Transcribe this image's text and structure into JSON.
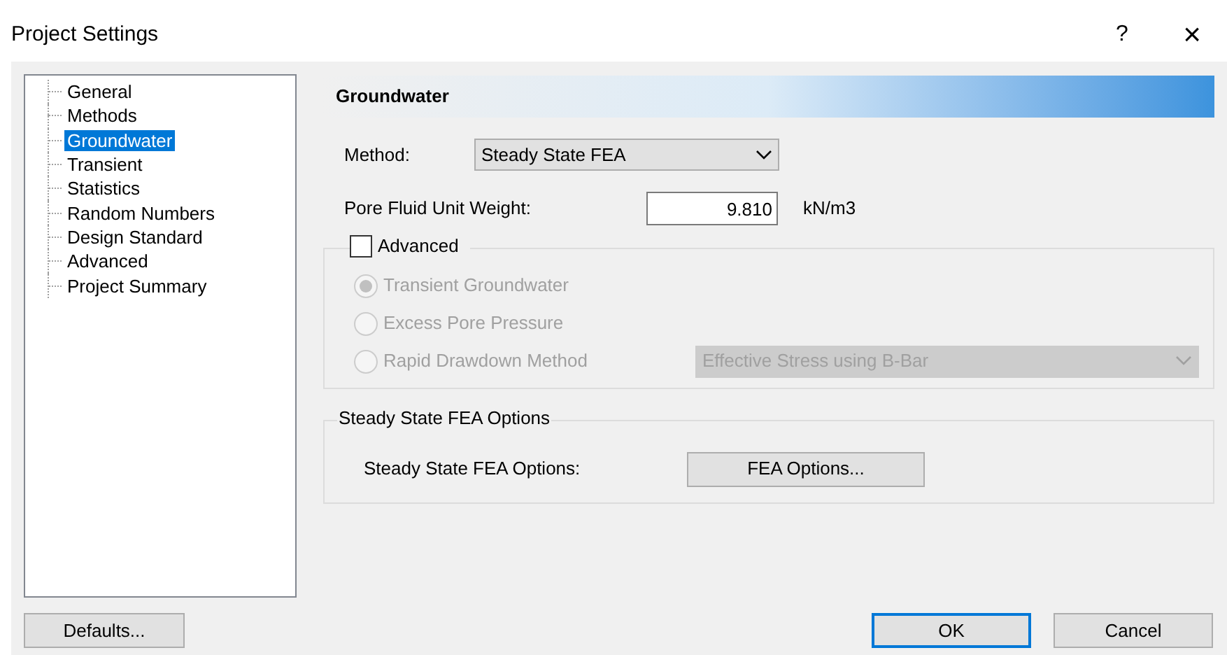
{
  "window": {
    "title": "Project Settings",
    "help": "?",
    "close": "×"
  },
  "tree": {
    "items": [
      {
        "label": "General",
        "selected": false
      },
      {
        "label": "Methods",
        "selected": false
      },
      {
        "label": "Groundwater",
        "selected": true
      },
      {
        "label": "Transient",
        "selected": false
      },
      {
        "label": "Statistics",
        "selected": false
      },
      {
        "label": "Random Numbers",
        "selected": false
      },
      {
        "label": "Design Standard",
        "selected": false
      },
      {
        "label": "Advanced",
        "selected": false
      },
      {
        "label": "Project Summary",
        "selected": false
      }
    ]
  },
  "panel": {
    "header": "Groundwater",
    "method": {
      "label": "Method:",
      "value": "Steady State FEA"
    },
    "unit_weight": {
      "label": "Pore Fluid Unit Weight:",
      "value": "9.810",
      "unit": "kN/m3"
    },
    "advanced": {
      "label": "Advanced",
      "checked": false,
      "options": [
        {
          "label": "Transient Groundwater",
          "selected": true,
          "disabled": true
        },
        {
          "label": "Excess Pore Pressure",
          "selected": false,
          "disabled": true
        },
        {
          "label": "Rapid Drawdown Method",
          "selected": false,
          "disabled": true
        }
      ],
      "drawdown_method": {
        "value": "Effective Stress using B-Bar",
        "disabled": true
      }
    },
    "fea_group": {
      "title": "Steady State FEA Options",
      "label": "Steady State FEA Options:",
      "button": "FEA Options..."
    }
  },
  "buttons": {
    "defaults": "Defaults...",
    "ok": "OK",
    "cancel": "Cancel"
  }
}
